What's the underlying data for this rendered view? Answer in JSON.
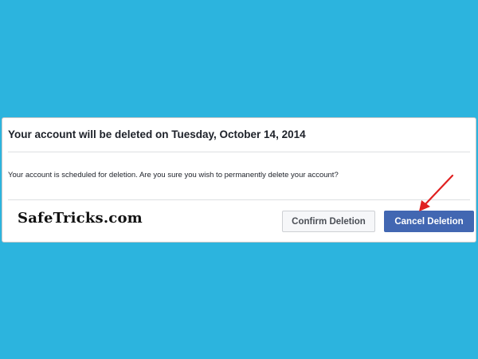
{
  "dialog": {
    "title": "Your account will be deleted on Tuesday, October 14, 2014",
    "message": "Your account is scheduled for deletion. Are you sure you wish to permanently delete your account?",
    "confirm_label": "Confirm Deletion",
    "cancel_label": "Cancel Deletion"
  },
  "watermark": {
    "text": "SafeTricks.com"
  },
  "annotation": {
    "icon": "red-arrow-icon",
    "color": "#e02020"
  },
  "colors": {
    "background": "#2cb4de",
    "primary_button": "#4267b2"
  }
}
